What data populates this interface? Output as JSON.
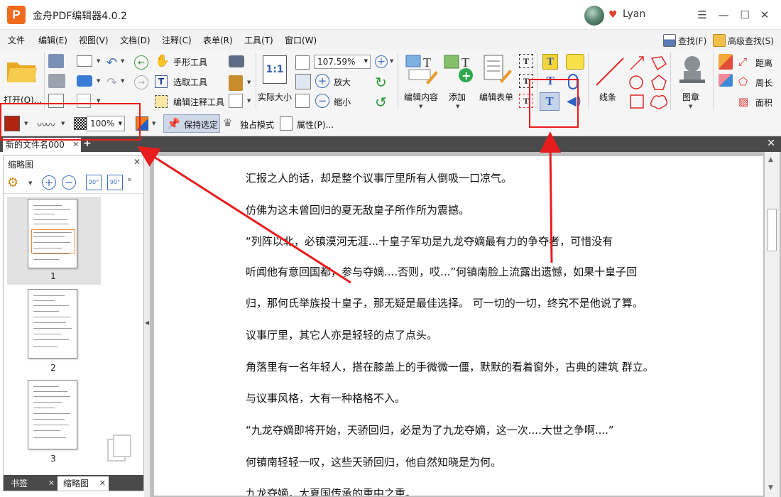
{
  "app": {
    "title": "金舟PDF编辑器4.0.2",
    "logo_letter": "P",
    "username": "Lyan"
  },
  "menu": [
    "文件",
    "编辑(E)",
    "视图(V)",
    "文档(D)",
    "注释(C)",
    "表单(R)",
    "工具(T)",
    "窗口(W)"
  ],
  "menu_right": {
    "find": "查找(F)",
    "advanced_find": "高级查找(S)"
  },
  "ribbon": {
    "open": "打开(O)...",
    "hand_tool": "手形工具",
    "select_tool": "选取工具",
    "edit_annotation_tool": "编辑注释工具",
    "actual_size": "实际大小",
    "zoom_value": "107.59%",
    "zoom_in": "放大",
    "zoom_out": "缩小",
    "edit_content": "编辑内容",
    "add": "添加",
    "edit_form": "编辑表单",
    "lines": "线条",
    "stamp": "图章",
    "distance": "距离",
    "perimeter": "周长",
    "area": "面积",
    "opacity": "100%",
    "keep_selected": "保持选定",
    "exclusive_mode": "独占模式",
    "properties": "属性(P)..."
  },
  "doc_tab": {
    "name": "新的文件名000"
  },
  "left_panel": {
    "title": "缩略图",
    "pages": [
      "1",
      "2",
      "3"
    ],
    "tabs": [
      "书签",
      "缩略图"
    ]
  },
  "document": {
    "paragraphs": [
      "汇报之人的话，却是整个议事厅里所有人倒吸一口凉气。",
      "仿佛为这未曾回归的夏无敌皇子所作所为震撼。",
      "“列阵以北，必镇漠河无涯...十皇子军功是九龙夺嫡最有力的争夺者，可惜没有",
      "听闻他有意回国都，参与夺嫡....否则，哎...”何镇南脸上流露出遗憾，如果十皇子回",
      "归，那何氏举族投十皇子，那无疑是最佳选择。        可一切的一切，终究不是他说了算。",
      "议事厅里，其它人亦是轻轻的点了点头。",
      "角落里有一名年轻人，搭在膝盖上的手微微一僵，默默的看着窗外，古典的建筑      群立。",
      "与议事风格，大有一种格格不入。",
      "“九龙夺嫡即将开始，天骄回归，必是为了九龙夺嫡，这一次....大世之争啊....”",
      "何镇南轻轻一叹，这些天骄回归，他自然知晓是为何。",
      "九龙夺嫡，大夏国传承的重中之重。"
    ]
  },
  "colors": {
    "annotation_red": "#e81c1c",
    "color_swatch": "#b1240f",
    "logo_orange": "#f06a1d"
  }
}
